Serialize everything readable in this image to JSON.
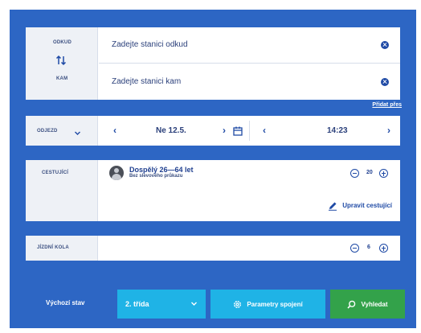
{
  "route": {
    "from_label": "ODKUD",
    "to_label": "KAM",
    "from_placeholder": "Zadejte stanici odkud",
    "to_placeholder": "Zadejte stanici kam",
    "add_via": "Přidat přes",
    "swap_icon": "swap-arrows-icon",
    "clear_icon": "clear-circle-icon"
  },
  "datetime": {
    "mode_label": "ODJEZD",
    "date": "Ne 12.5.",
    "time": "14:23",
    "prev_icon": "chevron-left-icon",
    "next_icon": "chevron-right-icon",
    "calendar_icon": "calendar-icon"
  },
  "passengers": {
    "label": "CESTUJÍCÍ",
    "type": "Dospělý 26—64 let",
    "discount": "Bez slevového průkazu",
    "count": "20",
    "edit_label": "Upravit cestující",
    "edit_icon": "pencil-icon"
  },
  "bikes": {
    "label": "JÍZDNÍ KOLA",
    "count": "6"
  },
  "footer": {
    "state_label": "Výchozí stav",
    "class_value": "2. třída",
    "params_label": "Parametry spojení",
    "search_label": "Vyhledat",
    "colors": {
      "panel": "#2d66c4",
      "class_button": "#1fb3e6",
      "params_button": "#1fb3e6",
      "search_button": "#33a24a"
    }
  }
}
